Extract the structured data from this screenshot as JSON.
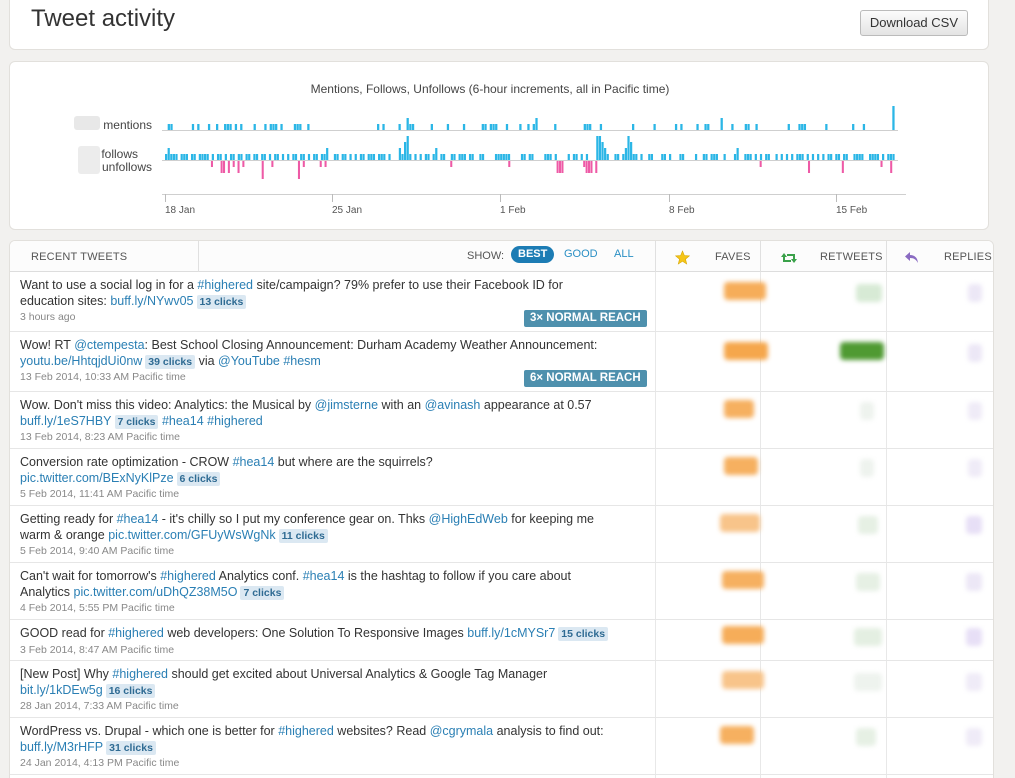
{
  "header": {
    "title": "Tweet activity",
    "download_label": "Download CSV"
  },
  "chart": {
    "title": "Mentions, Follows, Unfollows (6-hour increments, all in Pacific time)",
    "row_labels": {
      "mentions": "mentions",
      "follows": "follows",
      "unfollows": "unfollows"
    },
    "x_ticks": [
      "18 Jan",
      "25 Jan",
      "1 Feb",
      "8 Feb",
      "15 Feb"
    ],
    "colors": {
      "mentions": "#2bb6e6",
      "follows": "#2bb6e6",
      "unfollows": "#ee5aa6"
    }
  },
  "chart_data": {
    "type": "bar",
    "title": "Mentions, Follows, Unfollows (6-hour increments, all in Pacific time)",
    "x_ticks": [
      "18 Jan",
      "25 Jan",
      "1 Feb",
      "8 Feb",
      "15 Feb"
    ],
    "series": [
      {
        "name": "mentions",
        "values": [
          0,
          1,
          1,
          0,
          0,
          0,
          0,
          0,
          0,
          0,
          1,
          0,
          1,
          0,
          0,
          0,
          1,
          0,
          0,
          1,
          0,
          0,
          1,
          1,
          1,
          0,
          1,
          0,
          1,
          0,
          0,
          0,
          0,
          1,
          0,
          0,
          0,
          1,
          0,
          1,
          1,
          1,
          0,
          1,
          0,
          0,
          0,
          0,
          1,
          1,
          1,
          0,
          0,
          1,
          0,
          0,
          0,
          0,
          0,
          0,
          0,
          0,
          0,
          0,
          0,
          0,
          0,
          0,
          0,
          0,
          0,
          0,
          0,
          0,
          0,
          0,
          0,
          0,
          0,
          1,
          0,
          1,
          0,
          0,
          0,
          0,
          0,
          1,
          0,
          0,
          2,
          1,
          1,
          0,
          0,
          0,
          0,
          0,
          0,
          1,
          0,
          0,
          0,
          0,
          0,
          1,
          0,
          0,
          0,
          0,
          0,
          1,
          0,
          0,
          0,
          0,
          0,
          0,
          1,
          1,
          0,
          1,
          1,
          1,
          0,
          0,
          0,
          1,
          0,
          0,
          0,
          0,
          1,
          0,
          0,
          1,
          0,
          1,
          2,
          0,
          0,
          0,
          0,
          0,
          0,
          1,
          0,
          0,
          0,
          0,
          0,
          0,
          0,
          0,
          0,
          0,
          1,
          1,
          1,
          0,
          0,
          0,
          1,
          0,
          0,
          0,
          0,
          0,
          0,
          0,
          0,
          0,
          0,
          0,
          1,
          0,
          0,
          0,
          0,
          0,
          0,
          0,
          1,
          0,
          0,
          0,
          0,
          0,
          0,
          0,
          1,
          0,
          1,
          0,
          0,
          0,
          0,
          0,
          1,
          0,
          0,
          1,
          1,
          0,
          0,
          0,
          0,
          2,
          0,
          0,
          0,
          1,
          0,
          0,
          0,
          0,
          1,
          1,
          0,
          0,
          1,
          0,
          0,
          0,
          0,
          0,
          0,
          0,
          0,
          0,
          0,
          0,
          1,
          0,
          0,
          0,
          1,
          1,
          1,
          0,
          0,
          0,
          0,
          0,
          0,
          0,
          1,
          0,
          0,
          0,
          0,
          0,
          0,
          0,
          0,
          0,
          1,
          0,
          0,
          0,
          1,
          0,
          0,
          0,
          0,
          0,
          0,
          0,
          0,
          0,
          0,
          4
        ]
      },
      {
        "name": "follows",
        "values": [
          1,
          2,
          1,
          1,
          1,
          0,
          1,
          1,
          1,
          0,
          1,
          1,
          0,
          1,
          1,
          1,
          1,
          0,
          1,
          0,
          1,
          1,
          0,
          1,
          0,
          1,
          1,
          0,
          1,
          1,
          0,
          1,
          1,
          0,
          1,
          1,
          0,
          1,
          1,
          0,
          1,
          0,
          1,
          1,
          0,
          1,
          0,
          1,
          0,
          1,
          1,
          0,
          1,
          1,
          0,
          1,
          0,
          1,
          1,
          0,
          1,
          1,
          2,
          0,
          0,
          1,
          1,
          0,
          1,
          1,
          0,
          1,
          0,
          1,
          0,
          1,
          1,
          0,
          1,
          1,
          1,
          0,
          1,
          1,
          1,
          0,
          1,
          0,
          0,
          0,
          2,
          1,
          3,
          4,
          1,
          0,
          1,
          0,
          1,
          0,
          1,
          1,
          0,
          1,
          2,
          0,
          1,
          1,
          0,
          0,
          1,
          1,
          0,
          1,
          1,
          1,
          0,
          1,
          1,
          0,
          0,
          1,
          1,
          0,
          0,
          0,
          0,
          1,
          1,
          1,
          1,
          1,
          1,
          0,
          0,
          0,
          0,
          1,
          1,
          0,
          1,
          1,
          0,
          0,
          0,
          0,
          1,
          1,
          1,
          0,
          1,
          0,
          0,
          0,
          0,
          1,
          0,
          1,
          1,
          0,
          1,
          0,
          1,
          0,
          0,
          0,
          4,
          4,
          3,
          2,
          1,
          0,
          0,
          1,
          1,
          0,
          1,
          2,
          4,
          3,
          1,
          1,
          0,
          1,
          0,
          0,
          1,
          1,
          0,
          0,
          0,
          1,
          1,
          0,
          1,
          0,
          0,
          0,
          1,
          1,
          0,
          0,
          0,
          0,
          1,
          0,
          0,
          1,
          1,
          0,
          1,
          1,
          1,
          0,
          0,
          1,
          0,
          0,
          0,
          1,
          2,
          0,
          0,
          1,
          1,
          1,
          0,
          1,
          0,
          1,
          0,
          1,
          1,
          0,
          0,
          1,
          0,
          1,
          0,
          1,
          0,
          1,
          0,
          1,
          1,
          1,
          0,
          1,
          0,
          1,
          0,
          1,
          0,
          1,
          0,
          1,
          1,
          0,
          1,
          1,
          0,
          1,
          1,
          0,
          0,
          1,
          1,
          1,
          1,
          0,
          0,
          1,
          1,
          1,
          1,
          0,
          1,
          0,
          1,
          1,
          1
        ]
      },
      {
        "name": "unfollows",
        "values": [
          0,
          0,
          0,
          0,
          0,
          0,
          0,
          0,
          0,
          0,
          0,
          0,
          0,
          0,
          0,
          0,
          0,
          0,
          0,
          1,
          0,
          0,
          0,
          2,
          2,
          0,
          2,
          0,
          1,
          0,
          2,
          0,
          1,
          0,
          0,
          0,
          0,
          0,
          0,
          0,
          3,
          0,
          0,
          0,
          1,
          0,
          0,
          0,
          0,
          0,
          0,
          0,
          0,
          0,
          0,
          3,
          0,
          1,
          0,
          0,
          0,
          0,
          0,
          0,
          1,
          0,
          1,
          0,
          0,
          0,
          0,
          0,
          0,
          0,
          0,
          0,
          0,
          0,
          0,
          0,
          0,
          0,
          0,
          0,
          0,
          0,
          0,
          0,
          0,
          0,
          0,
          0,
          0,
          0,
          0,
          0,
          0,
          0,
          0,
          0,
          0,
          0,
          0,
          0,
          0,
          0,
          0,
          0,
          0,
          0,
          0,
          0,
          0,
          0,
          0,
          0,
          0,
          0,
          1,
          0,
          0,
          0,
          0,
          0,
          0,
          0,
          0,
          0,
          0,
          0,
          0,
          0,
          0,
          0,
          0,
          0,
          0,
          0,
          0,
          0,
          0,
          0,
          1,
          0,
          0,
          0,
          0,
          0,
          0,
          0,
          0,
          0,
          0,
          0,
          0,
          0,
          0,
          0,
          0,
          0,
          0,
          0,
          2,
          2,
          2,
          0,
          0,
          0,
          0,
          0,
          0,
          0,
          0,
          1,
          2,
          2,
          2,
          0,
          2,
          0,
          0,
          0,
          0,
          0,
          0,
          0,
          0,
          0,
          0,
          0,
          0,
          0,
          0,
          0,
          0,
          0,
          0,
          0,
          0,
          0,
          0,
          0,
          0,
          0,
          0,
          0,
          0,
          0,
          0,
          0,
          0,
          0,
          0,
          0,
          0,
          0,
          0,
          0,
          0,
          0,
          0,
          0,
          0,
          0,
          0,
          0,
          0,
          0,
          0,
          0,
          0,
          0,
          0,
          0,
          0,
          0,
          0,
          0,
          0,
          0,
          0,
          0,
          0,
          0,
          0,
          0,
          1,
          0,
          0,
          0,
          0,
          0,
          0,
          0,
          0,
          0,
          0,
          0,
          0,
          0,
          0,
          0,
          0,
          0,
          0,
          0,
          2,
          0,
          0,
          0,
          0,
          0,
          0,
          0,
          0,
          0,
          0,
          0,
          0,
          0,
          2,
          0,
          0,
          0,
          0,
          0,
          0,
          0,
          0,
          0,
          0,
          0,
          0,
          0,
          0,
          0,
          1,
          0,
          0,
          0,
          2,
          0
        ]
      }
    ]
  },
  "table": {
    "headers": {
      "recent": "RECENT TWEETS",
      "show": "SHOW:",
      "faves": "FAVES",
      "retweets": "RETWEETS",
      "replies": "REPLIES"
    },
    "filters": [
      "BEST",
      "GOOD",
      "ALL"
    ],
    "active_filter": "BEST",
    "tweets": [
      {
        "line1_a": "Want to use a social log in for a ",
        "tag1": "#highered",
        "line1_b": " site/campaign? 79% prefer to use their Facebook ID for",
        "line2_a": "education sites: ",
        "link": "buff.ly/NYwv05",
        "clicks": "13 clicks",
        "time": "3 hours ago",
        "reach": "3× NORMAL REACH"
      },
      {
        "line1_a": "Wow! RT ",
        "mention": "@ctempesta",
        "line1_b": ": Best School Closing Announcement: Durham Academy Weather Announcement:",
        "link": "youtu.be/HhtqjdUi0nw",
        "clicks": "39 clicks",
        "line2_b": " via ",
        "mention2": "@YouTube",
        "tag2": "#hesm",
        "time": "13 Feb 2014, 10:33 AM Pacific time",
        "reach": "6× NORMAL REACH"
      },
      {
        "line1_a": "Wow. Don't miss this video: Analytics: the Musical by ",
        "mention": "@jimsterne",
        "line1_b": " with an ",
        "mention2": "@avinash",
        "line1_c": " appearance at 0.57",
        "link": "buff.ly/1eS7HBY",
        "clicks": "7 clicks",
        "tag1": "#hea14",
        "tag2": "#highered",
        "time": "13 Feb 2014, 8:23 AM Pacific time"
      },
      {
        "line1_a": "Conversion rate optimization - CROW ",
        "tag1": "#hea14",
        "line1_b": " but where are the squirrels?",
        "link": "pic.twitter.com/BExNyKlPze",
        "clicks": "6 clicks",
        "time": "5 Feb 2014, 11:41 AM Pacific time"
      },
      {
        "line1_a": "Getting ready for ",
        "tag1": "#hea14",
        "line1_b": " - it's chilly so I put my conference gear on. Thks ",
        "mention": "@HighEdWeb",
        "line1_c": " for keeping me",
        "line2_a": "warm & orange ",
        "link": "pic.twitter.com/GFUyWsWgNk",
        "clicks": "11 clicks",
        "time": "5 Feb 2014, 9:40 AM Pacific time"
      },
      {
        "line1_a": "Can't wait for tomorrow's ",
        "tag1": "#highered",
        "line1_b": " Analytics conf. ",
        "tag2": "#hea14",
        "line1_c": " is the hashtag to follow if you care about",
        "line2_a": "Analytics ",
        "link": "pic.twitter.com/uDhQZ38M5O",
        "clicks": "7 clicks",
        "time": "4 Feb 2014, 5:55 PM Pacific time"
      },
      {
        "line1_a": "GOOD read for ",
        "tag1": "#highered",
        "line1_b": " web developers: One Solution To Responsive Images ",
        "link": "buff.ly/1cMYSr7",
        "clicks": "15 clicks",
        "time": "3 Feb 2014, 8:47 AM Pacific time"
      },
      {
        "line1_a": "[New Post] Why ",
        "tag1": "#highered",
        "line1_b": " should get excited about Universal Analytics & Google Tag Manager",
        "link": "bit.ly/1kDEw5g",
        "clicks": "16 clicks",
        "time": "28 Jan 2014, 7:33 AM Pacific time"
      },
      {
        "line1_a": "WordPress vs. Drupal - which one is better for ",
        "tag1": "#highered",
        "line1_b": " websites? Read ",
        "mention": "@cgrymala",
        "line1_c": " analysis to find out:",
        "link": "buff.ly/M3rHFP",
        "clicks": "31 clicks",
        "time": "24 Jan 2014, 4:13 PM Pacific time"
      }
    ]
  }
}
